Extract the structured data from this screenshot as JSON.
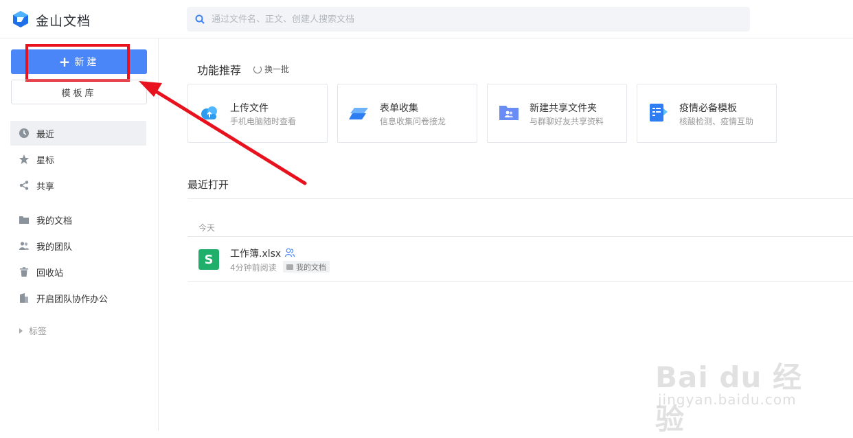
{
  "header": {
    "app_title": "金山文档",
    "search_placeholder": "通过文件名、正文、创建人搜索文档",
    "logo_icon": "wps-docs-logo-icon",
    "search_icon": "search-icon"
  },
  "sidebar": {
    "new_label": "新建",
    "template_label": "模板库",
    "items": [
      {
        "label": "最近",
        "icon": "clock-icon",
        "active": true
      },
      {
        "label": "星标",
        "icon": "star-icon",
        "active": false
      },
      {
        "label": "共享",
        "icon": "share-icon",
        "active": false
      },
      {
        "label": "我的文档",
        "icon": "folder-icon",
        "active": false
      },
      {
        "label": "我的团队",
        "icon": "team-icon",
        "active": false
      },
      {
        "label": "回收站",
        "icon": "trash-icon",
        "active": false
      },
      {
        "label": "开启团队协作办公",
        "icon": "building-icon",
        "active": false
      }
    ],
    "tags_label": "标签"
  },
  "main": {
    "recommend_title": "功能推荐",
    "refresh_label": "换一批",
    "cards": [
      {
        "title": "上传文件",
        "subtitle": "手机电脑随时查看",
        "icon": "cloud-upload-icon"
      },
      {
        "title": "表单收集",
        "subtitle": "信息收集问卷接龙",
        "icon": "form-icon"
      },
      {
        "title": "新建共享文件夹",
        "subtitle": "与群聊好友共享资料",
        "icon": "shared-folder-icon"
      },
      {
        "title": "疫情必备模板",
        "subtitle": "核酸检测、疫情互助",
        "icon": "template-doc-icon"
      }
    ],
    "recent_title": "最近打开",
    "group_label": "今天",
    "files": [
      {
        "name": "工作簿.xlsx",
        "meta": "4分钟前阅读",
        "location": "我的文档",
        "icon": "spreadsheet-icon",
        "icon_letter": "S"
      }
    ]
  },
  "watermark": {
    "line1": "Bai du 经验",
    "line2": "jingyan.baidu.com"
  },
  "colors": {
    "accent": "#4a86f7",
    "annotation_red": "#e8121f",
    "sheet_green": "#1faf6a"
  }
}
